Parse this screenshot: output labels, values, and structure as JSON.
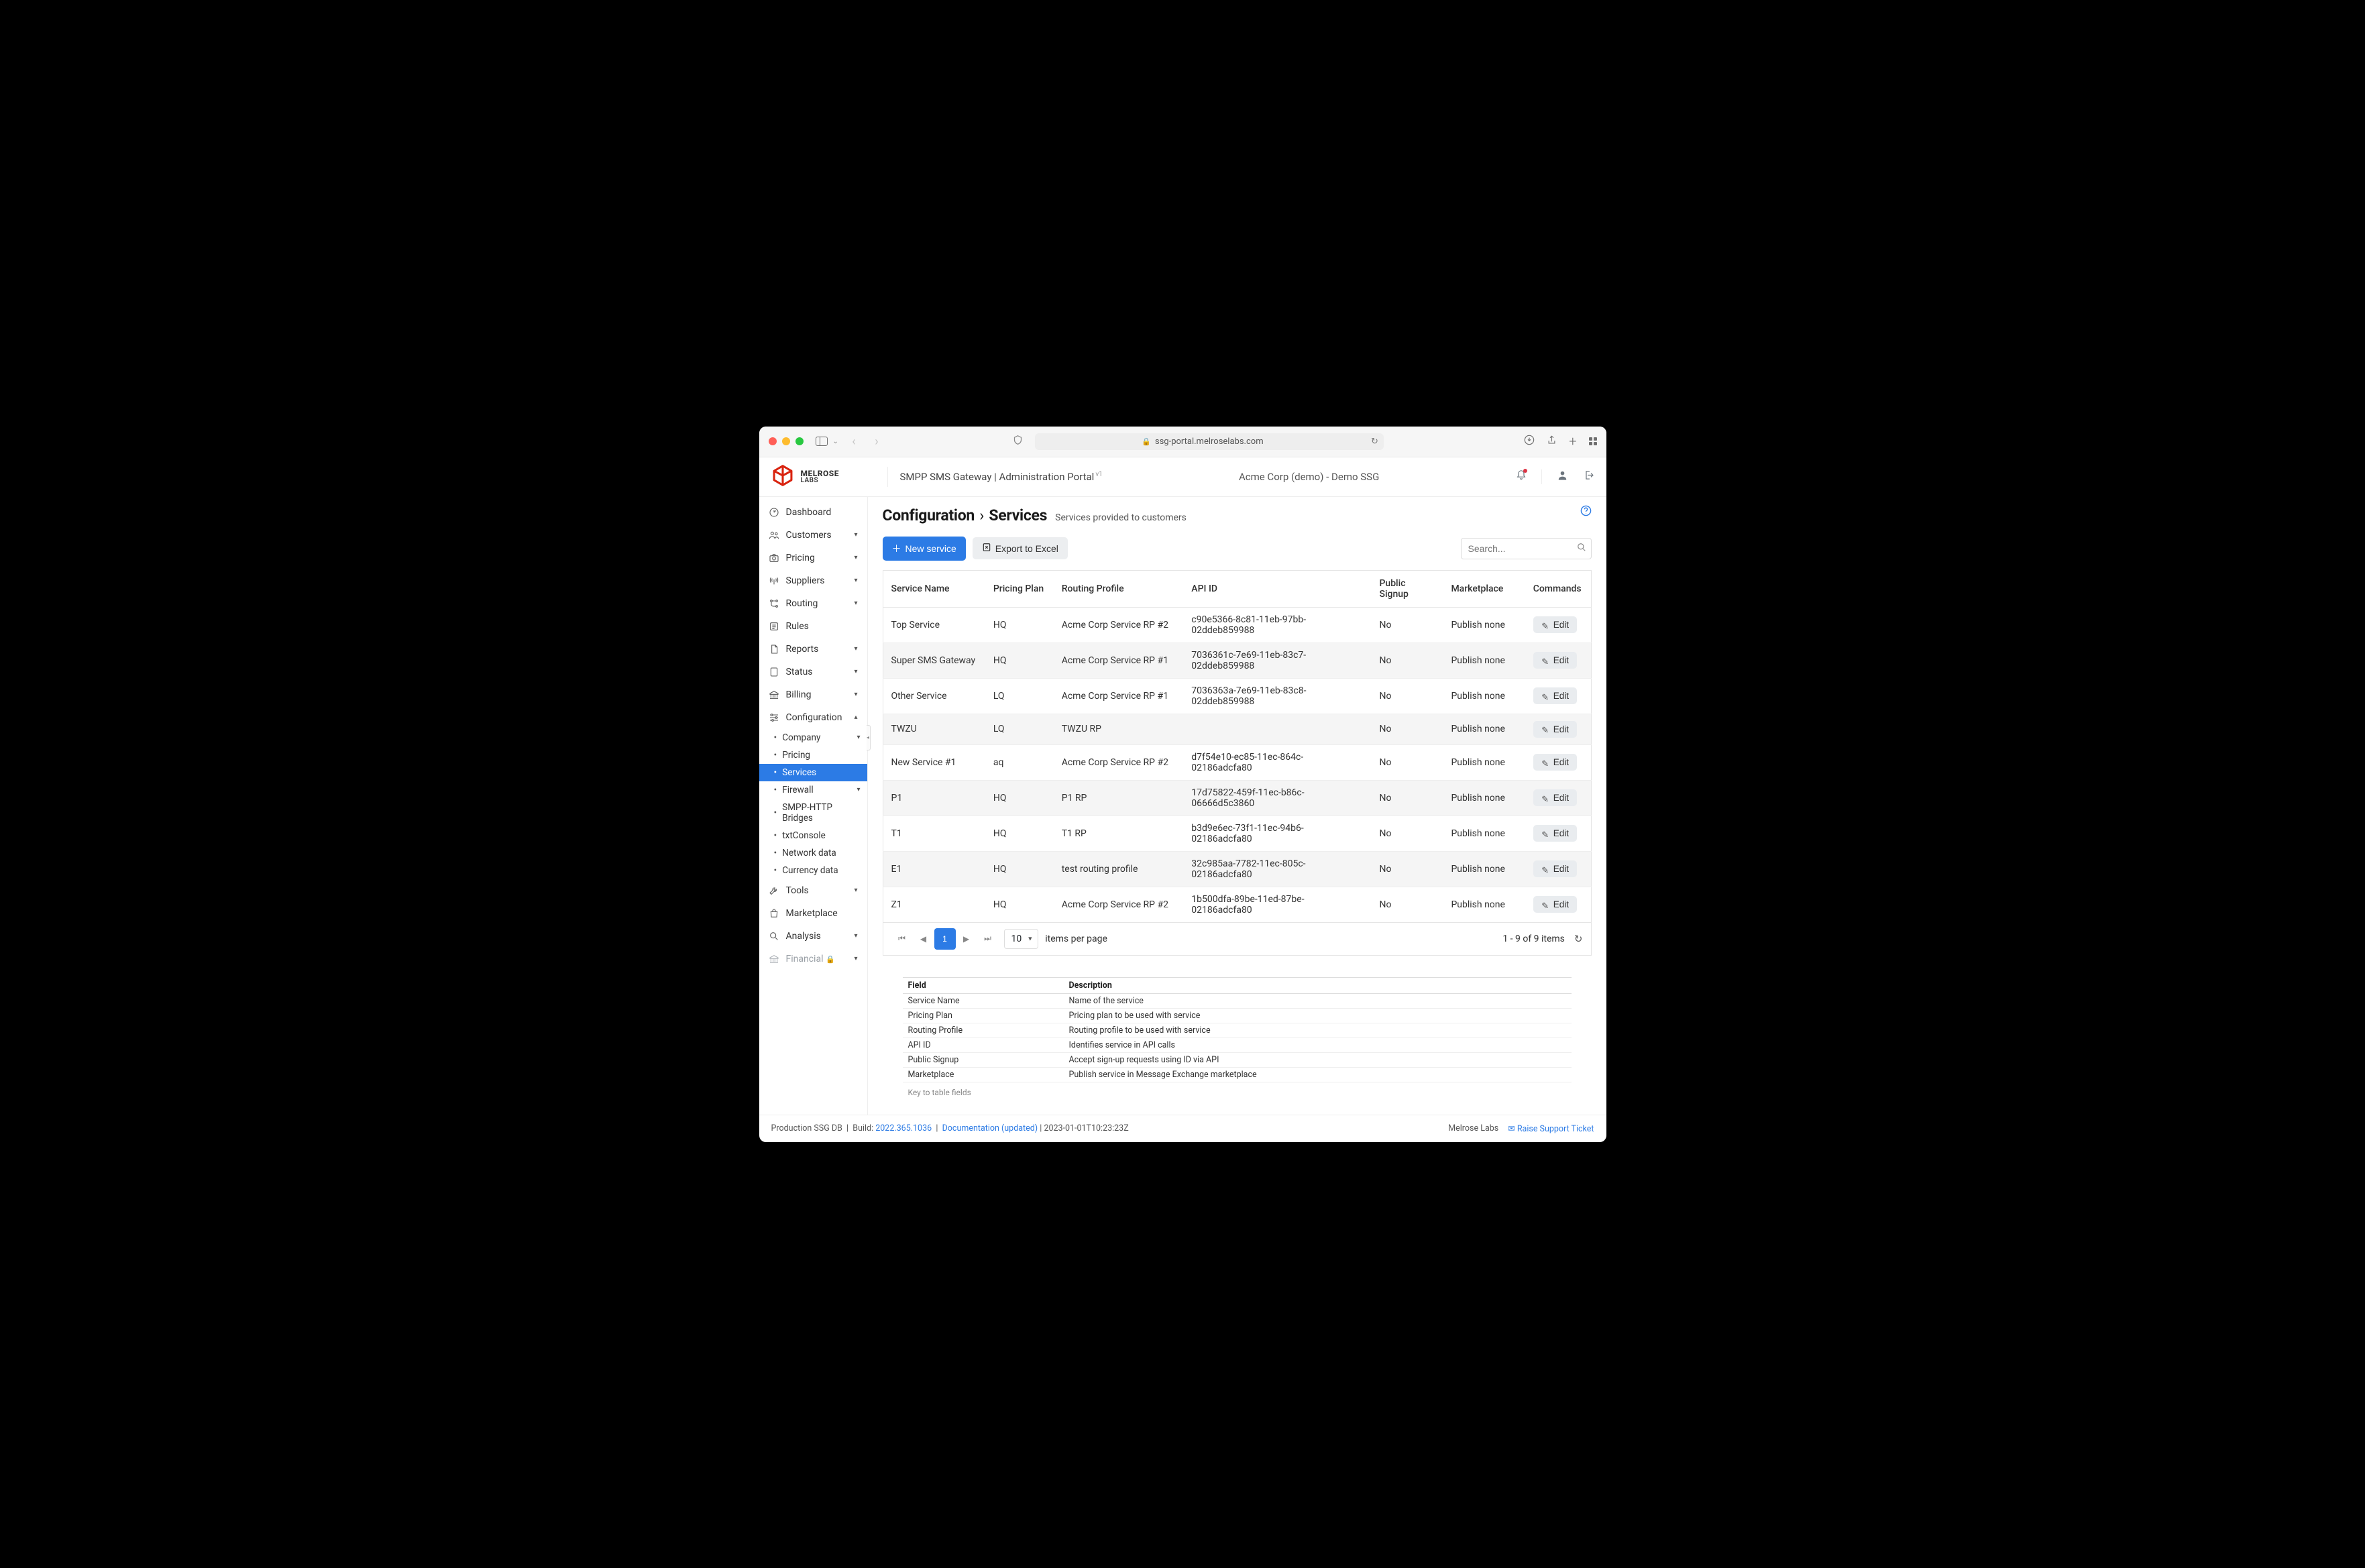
{
  "browser": {
    "url": "ssg-portal.melroselabs.com"
  },
  "brand": {
    "name1": "MELROSE",
    "name2": "LABS"
  },
  "header": {
    "portal_title": "SMPP SMS Gateway | Administration Portal",
    "portal_version": "v1",
    "tenant": "Acme Corp (demo) - Demo SSG"
  },
  "sidebar": {
    "items": [
      {
        "key": "dashboard",
        "label": "Dashboard",
        "icon": "gauge",
        "caret": false
      },
      {
        "key": "customers",
        "label": "Customers",
        "icon": "users",
        "caret": true
      },
      {
        "key": "pricing",
        "label": "Pricing",
        "icon": "camera",
        "caret": true
      },
      {
        "key": "suppliers",
        "label": "Suppliers",
        "icon": "antenna",
        "caret": true
      },
      {
        "key": "routing",
        "label": "Routing",
        "icon": "route",
        "caret": true
      },
      {
        "key": "rules",
        "label": "Rules",
        "icon": "rules",
        "caret": false
      },
      {
        "key": "reports",
        "label": "Reports",
        "icon": "file",
        "caret": true
      },
      {
        "key": "status",
        "label": "Status",
        "icon": "server",
        "caret": true
      },
      {
        "key": "billing",
        "label": "Billing",
        "icon": "bank",
        "caret": true
      },
      {
        "key": "configuration",
        "label": "Configuration",
        "icon": "sliders",
        "caret": true,
        "expanded": true,
        "children": [
          {
            "label": "Company",
            "caret": true
          },
          {
            "label": "Pricing",
            "caret": false
          },
          {
            "label": "Services",
            "caret": false,
            "active": true
          },
          {
            "label": "Firewall",
            "caret": true
          },
          {
            "label": "SMPP-HTTP Bridges",
            "caret": false
          },
          {
            "label": "txtConsole",
            "caret": false
          },
          {
            "label": "Network data",
            "caret": false
          },
          {
            "label": "Currency data",
            "caret": false
          }
        ]
      },
      {
        "key": "tools",
        "label": "Tools",
        "icon": "wrench",
        "caret": true
      },
      {
        "key": "marketplace",
        "label": "Marketplace",
        "icon": "bag",
        "caret": false
      },
      {
        "key": "analysis",
        "label": "Analysis",
        "icon": "magnifier",
        "caret": true
      },
      {
        "key": "financial",
        "label": "Financial",
        "icon": "bank",
        "caret": true,
        "locked": true,
        "disabled": true
      }
    ]
  },
  "page": {
    "crumb_root": "Configuration",
    "crumb_leaf": "Services",
    "subtitle": "Services provided to customers"
  },
  "toolbar": {
    "new_label": "New service",
    "export_label": "Export to Excel",
    "search_placeholder": "Search..."
  },
  "grid": {
    "columns": [
      "Service Name",
      "Pricing Plan",
      "Routing Profile",
      "API ID",
      "Public Signup",
      "Marketplace",
      "Commands"
    ],
    "edit_label": "Edit",
    "rows": [
      {
        "name": "Top Service",
        "plan": "HQ",
        "route": "Acme Corp Service RP #2",
        "api": "c90e5366-8c81-11eb-97bb-02ddeb859988",
        "signup": "No",
        "market": "Publish none"
      },
      {
        "name": "Super SMS Gateway",
        "plan": "HQ",
        "route": "Acme Corp Service RP #1",
        "api": "7036361c-7e69-11eb-83c7-02ddeb859988",
        "signup": "No",
        "market": "Publish none"
      },
      {
        "name": "Other Service",
        "plan": "LQ",
        "route": "Acme Corp Service RP #1",
        "api": "7036363a-7e69-11eb-83c8-02ddeb859988",
        "signup": "No",
        "market": "Publish none"
      },
      {
        "name": "TWZU",
        "plan": "LQ",
        "route": "TWZU RP",
        "api": "",
        "signup": "No",
        "market": "Publish none"
      },
      {
        "name": "New Service #1",
        "plan": "aq",
        "route": "Acme Corp Service RP #2",
        "api": "d7f54e10-ec85-11ec-864c-02186adcfa80",
        "signup": "No",
        "market": "Publish none"
      },
      {
        "name": "P1",
        "plan": "HQ",
        "route": "P1 RP",
        "api": "17d75822-459f-11ec-b86c-06666d5c3860",
        "signup": "No",
        "market": "Publish none"
      },
      {
        "name": "T1",
        "plan": "HQ",
        "route": "T1 RP",
        "api": "b3d9e6ec-73f1-11ec-94b6-02186adcfa80",
        "signup": "No",
        "market": "Publish none"
      },
      {
        "name": "E1",
        "plan": "HQ",
        "route": "test routing profile",
        "api": "32c985aa-7782-11ec-805c-02186adcfa80",
        "signup": "No",
        "market": "Publish none"
      },
      {
        "name": "Z1",
        "plan": "HQ",
        "route": "Acme Corp Service RP #2",
        "api": "1b500dfa-89be-11ed-87be-02186adcfa80",
        "signup": "No",
        "market": "Publish none"
      }
    ]
  },
  "pager": {
    "page": "1",
    "page_size": "10",
    "items_label": "items per page",
    "info": "1 - 9 of 9 items"
  },
  "fields": {
    "col_field": "Field",
    "col_desc": "Description",
    "caption": "Key to table fields",
    "rows": [
      {
        "f": "Service Name",
        "d": "Name of the service"
      },
      {
        "f": "Pricing Plan",
        "d": "Pricing plan to be used with service"
      },
      {
        "f": "Routing Profile",
        "d": "Routing profile to be used with service"
      },
      {
        "f": "API ID",
        "d": "Identifies service in API calls"
      },
      {
        "f": "Public Signup",
        "d": "Accept sign-up requests using ID via API"
      },
      {
        "f": "Marketplace",
        "d": "Publish service in Message Exchange marketplace"
      }
    ]
  },
  "footer": {
    "env": "Production SSG DB",
    "build_label": "Build:",
    "build_value": "2022.365.1036",
    "doc_label": "Documentation (updated)",
    "timestamp": "2023-01-01T10:23:23Z",
    "company": "Melrose Labs",
    "support": "Raise Support Ticket"
  }
}
